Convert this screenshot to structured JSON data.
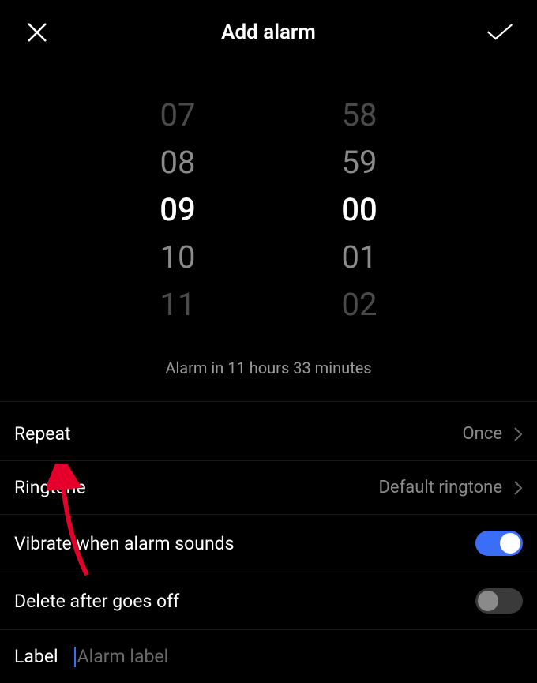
{
  "header": {
    "title": "Add alarm"
  },
  "timePicker": {
    "hours": {
      "far_above": "07",
      "above": "08",
      "selected": "09",
      "below": "10",
      "far_below": "11"
    },
    "minutes": {
      "far_above": "58",
      "above": "59",
      "selected": "00",
      "below": "01",
      "far_below": "02"
    }
  },
  "alarmInfo": "Alarm in 11 hours 33 minutes",
  "settings": {
    "repeat": {
      "label": "Repeat",
      "value": "Once"
    },
    "ringtone": {
      "label": "Ringtone",
      "value": "Default ringtone"
    },
    "vibrate": {
      "label": "Vibrate when alarm sounds",
      "enabled": true
    },
    "deleteAfter": {
      "label": "Delete after goes off",
      "enabled": false
    },
    "labelField": {
      "label": "Label",
      "placeholder": "Alarm label",
      "value": ""
    }
  }
}
